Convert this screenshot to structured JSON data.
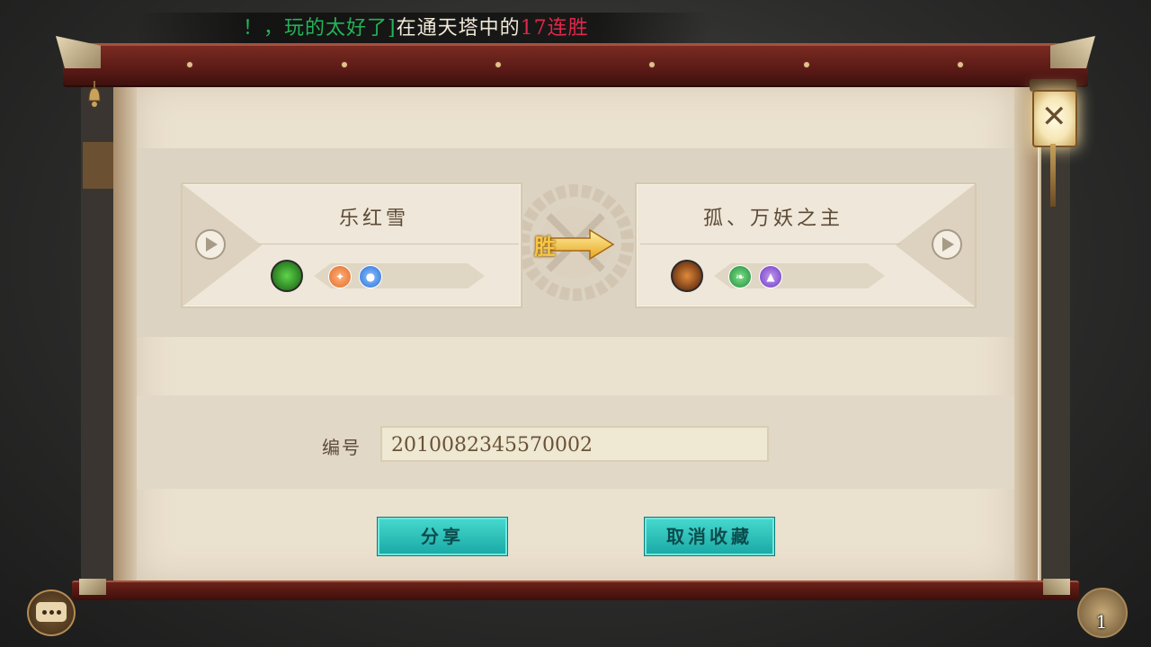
{
  "marquee": {
    "green_part": "！，玩的太好了]",
    "white_part": "在通天塔中的",
    "red_part": "17连胜"
  },
  "battle": {
    "result_label": "胜",
    "left_player": {
      "name": "乐红雪",
      "character_icon": "green-dragon-icon",
      "skills": [
        "orange-star-skill-icon",
        "blue-water-skill-icon"
      ]
    },
    "right_player": {
      "name": "孤、万妖之主",
      "character_icon": "fire-beast-icon",
      "skills": [
        "green-leaf-skill-icon",
        "purple-triangle-skill-icon"
      ]
    }
  },
  "record": {
    "id_label": "编号",
    "id_value": "2010082345570002"
  },
  "buttons": {
    "share_label": "分享",
    "cancel_favorite_label": "取消收藏"
  },
  "resource_badge": {
    "count": "1"
  },
  "colors": {
    "button_teal": "#2cc3bd",
    "scroll_red": "#6c2118",
    "paper": "#ebe1cf",
    "win_gold": "#f6c644"
  }
}
